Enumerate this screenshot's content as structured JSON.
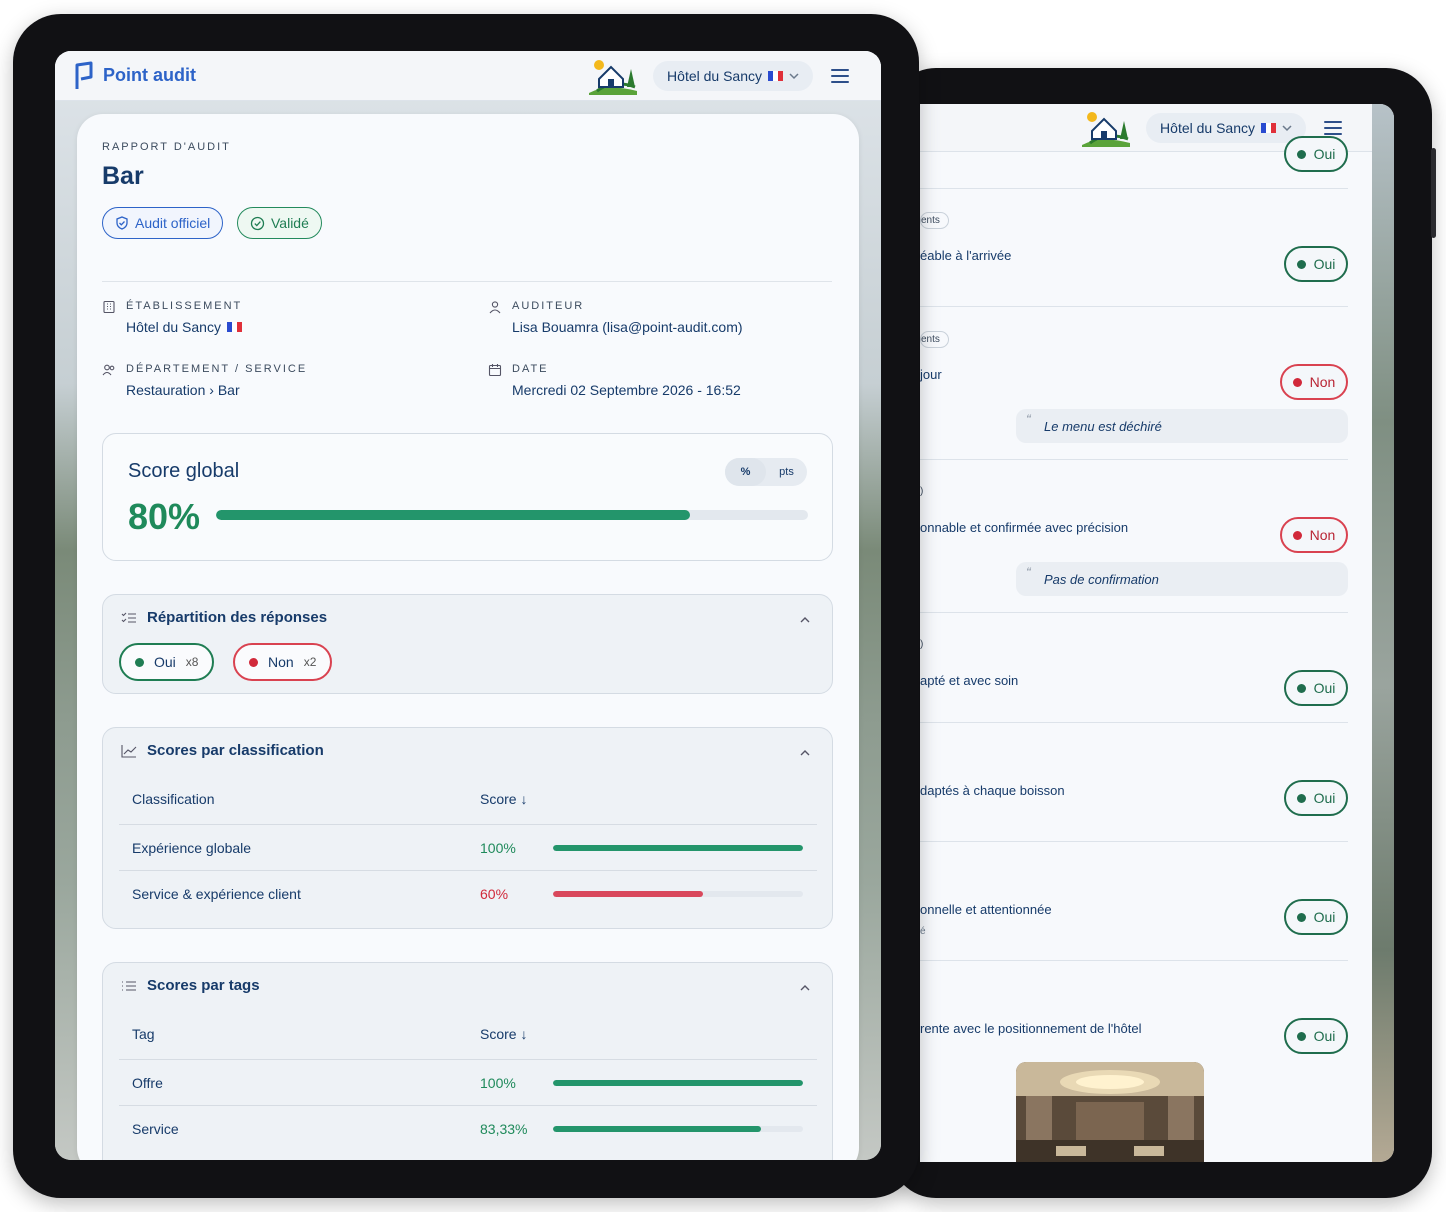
{
  "app": {
    "name": "Point audit",
    "hotel": "Hôtel du Sancy"
  },
  "report": {
    "eyebrow": "RAPPORT D'AUDIT",
    "title": "Bar",
    "badges": {
      "official": "Audit officiel",
      "validated": "Validé"
    },
    "establishment": {
      "label": "ÉTABLISSEMENT",
      "value": "Hôtel du Sancy"
    },
    "auditor": {
      "label": "AUDITEUR",
      "value": "Lisa Bouamra (lisa@point-audit.com)"
    },
    "department": {
      "label": "DÉPARTEMENT / SERVICE",
      "value": "Restauration › Bar"
    },
    "date": {
      "label": "DATE",
      "value": "Mercredi 02 Septembre 2026 - 16:52"
    }
  },
  "score": {
    "title": "Score global",
    "value": "80%",
    "fraction": 0.8,
    "toggle_pct": "%",
    "toggle_pts": "pts"
  },
  "distribution": {
    "title": "Répartition des réponses",
    "yes": {
      "label": "Oui",
      "count": "x8"
    },
    "no": {
      "label": "Non",
      "count": "x2"
    }
  },
  "classification": {
    "title": "Scores par classification",
    "col1": "Classification",
    "col2": "Score ↓",
    "rows": [
      {
        "label": "Expérience globale",
        "pct": "100%",
        "value": 1.0,
        "status": "good"
      },
      {
        "label": "Service & expérience client",
        "pct": "60%",
        "value": 0.6,
        "status": "bad"
      }
    ]
  },
  "tags": {
    "title": "Scores par tags",
    "col1": "Tag",
    "col2": "Score ↓",
    "rows": [
      {
        "label": "Offre",
        "pct": "100%",
        "value": 1.0,
        "status": "good"
      },
      {
        "label": "Service",
        "pct": "83,33%",
        "value": 0.8333,
        "status": "good"
      }
    ]
  },
  "back": {
    "hotel": "Hôtel du Sancy",
    "top_answer": "Oui",
    "items": [
      {
        "tag": "ents",
        "text": "éable à l'arrivée",
        "answer": "Oui",
        "status": "yes"
      },
      {
        "tag": "ents",
        "text": "jour",
        "answer": "Non",
        "status": "no",
        "comment": "Le menu est déchiré"
      },
      {
        "tag": ")",
        "text": "onnable et confirmée avec précision",
        "answer": "Non",
        "status": "no",
        "comment": "Pas de confirmation"
      },
      {
        "tag": ")",
        "text": "apté et avec soin",
        "answer": "Oui",
        "status": "yes"
      },
      {
        "tag": "",
        "text": "daptés à chaque boisson",
        "answer": "Oui",
        "status": "yes"
      },
      {
        "tag": "",
        "text": "onnelle et attentionnée",
        "sub": "é",
        "answer": "Oui",
        "status": "yes"
      },
      {
        "tag": "",
        "text": "rente avec le positionnement de l'hôtel",
        "answer": "Oui",
        "status": "yes"
      }
    ]
  },
  "colors": {
    "brand": "#2d63c8",
    "navy": "#173b6a",
    "green": "#1f8a5b",
    "red": "#d1293a"
  }
}
